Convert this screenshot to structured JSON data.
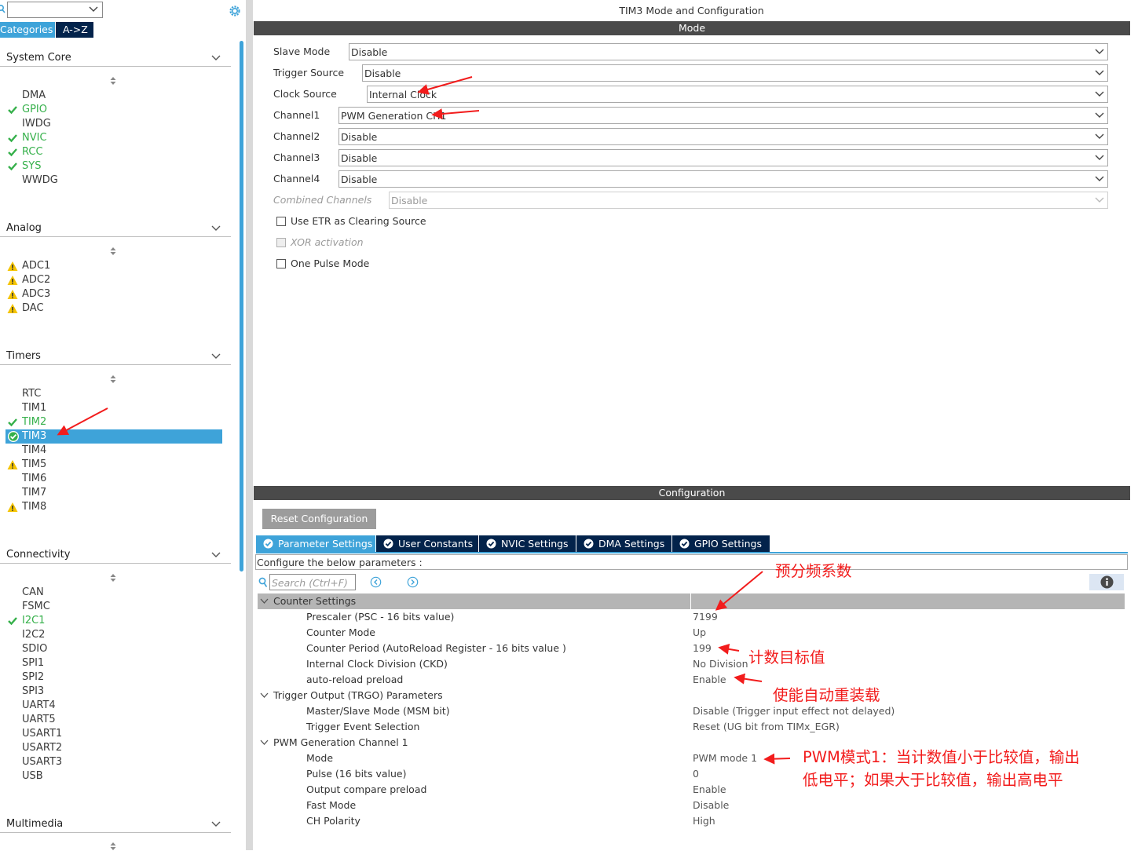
{
  "sidebar": {
    "tabs": {
      "categories": "Categories",
      "az": "A->Z"
    },
    "sections": [
      {
        "title": "System Core",
        "items": [
          {
            "label": "DMA",
            "status": "none"
          },
          {
            "label": "GPIO",
            "status": "ok"
          },
          {
            "label": "IWDG",
            "status": "none"
          },
          {
            "label": "NVIC",
            "status": "ok"
          },
          {
            "label": "RCC",
            "status": "ok"
          },
          {
            "label": "SYS",
            "status": "ok"
          },
          {
            "label": "WWDG",
            "status": "none"
          }
        ]
      },
      {
        "title": "Analog",
        "items": [
          {
            "label": "ADC1",
            "status": "warn"
          },
          {
            "label": "ADC2",
            "status": "warn"
          },
          {
            "label": "ADC3",
            "status": "warn"
          },
          {
            "label": "DAC",
            "status": "warn"
          }
        ]
      },
      {
        "title": "Timers",
        "items": [
          {
            "label": "RTC",
            "status": "none"
          },
          {
            "label": "TIM1",
            "status": "none"
          },
          {
            "label": "TIM2",
            "status": "ok"
          },
          {
            "label": "TIM3",
            "status": "selected"
          },
          {
            "label": "TIM4",
            "status": "none"
          },
          {
            "label": "TIM5",
            "status": "warn"
          },
          {
            "label": "TIM6",
            "status": "none"
          },
          {
            "label": "TIM7",
            "status": "none"
          },
          {
            "label": "TIM8",
            "status": "warn"
          }
        ]
      },
      {
        "title": "Connectivity",
        "items": [
          {
            "label": "CAN",
            "status": "none"
          },
          {
            "label": "FSMC",
            "status": "none"
          },
          {
            "label": "I2C1",
            "status": "ok"
          },
          {
            "label": "I2C2",
            "status": "none"
          },
          {
            "label": "SDIO",
            "status": "none"
          },
          {
            "label": "SPI1",
            "status": "none"
          },
          {
            "label": "SPI2",
            "status": "none"
          },
          {
            "label": "SPI3",
            "status": "none"
          },
          {
            "label": "UART4",
            "status": "none"
          },
          {
            "label": "UART5",
            "status": "none"
          },
          {
            "label": "USART1",
            "status": "none"
          },
          {
            "label": "USART2",
            "status": "none"
          },
          {
            "label": "USART3",
            "status": "none"
          },
          {
            "label": "USB",
            "status": "none"
          }
        ]
      },
      {
        "title": "Multimedia",
        "items": []
      }
    ]
  },
  "main": {
    "title": "TIM3 Mode and Configuration",
    "mode_header": "Mode",
    "mode_rows": [
      {
        "label": "Slave Mode",
        "value": "Disable",
        "disabled": false
      },
      {
        "label": "Trigger Source",
        "value": "Disable",
        "disabled": false
      },
      {
        "label": "Clock Source",
        "value": "Internal Clock",
        "disabled": false
      },
      {
        "label": "Channel1",
        "value": "PWM Generation CH1",
        "disabled": false
      },
      {
        "label": "Channel2",
        "value": "Disable",
        "disabled": false
      },
      {
        "label": "Channel3",
        "value": "Disable",
        "disabled": false
      },
      {
        "label": "Channel4",
        "value": "Disable",
        "disabled": false
      },
      {
        "label": "Combined Channels",
        "value": "Disable",
        "disabled": true
      }
    ],
    "checkboxes": [
      {
        "label": "Use ETR as Clearing Source",
        "checked": false,
        "disabled": false
      },
      {
        "label": "XOR activation",
        "checked": false,
        "disabled": true
      },
      {
        "label": "One Pulse Mode",
        "checked": false,
        "disabled": false
      }
    ],
    "config_header": "Configuration",
    "reset_button": "Reset Configuration",
    "config_tabs": [
      {
        "label": "Parameter Settings",
        "active": true
      },
      {
        "label": "User Constants",
        "active": false
      },
      {
        "label": "NVIC Settings",
        "active": false
      },
      {
        "label": "DMA Settings",
        "active": false
      },
      {
        "label": "GPIO Settings",
        "active": false
      }
    ],
    "description": "Configure the below parameters :",
    "search_placeholder": "Search (Ctrl+F)",
    "parameters": [
      {
        "kind": "group",
        "name": "Counter Settings",
        "value": "",
        "highlight": true
      },
      {
        "kind": "leaf",
        "name": "Prescaler (PSC - 16 bits value)",
        "value": "7199"
      },
      {
        "kind": "leaf",
        "name": "Counter Mode",
        "value": "Up"
      },
      {
        "kind": "leaf",
        "name": "Counter Period (AutoReload Register - 16 bits value )",
        "value": "199"
      },
      {
        "kind": "leaf",
        "name": "Internal Clock Division (CKD)",
        "value": "No Division"
      },
      {
        "kind": "leaf",
        "name": "auto-reload preload",
        "value": "Enable"
      },
      {
        "kind": "group",
        "name": "Trigger Output (TRGO) Parameters",
        "value": "",
        "highlight": false
      },
      {
        "kind": "leaf",
        "name": "Master/Slave Mode (MSM bit)",
        "value": "Disable (Trigger input effect not delayed)"
      },
      {
        "kind": "leaf",
        "name": "Trigger Event Selection",
        "value": "Reset (UG bit from TIMx_EGR)"
      },
      {
        "kind": "group",
        "name": "PWM Generation Channel 1",
        "value": "",
        "highlight": false
      },
      {
        "kind": "leaf",
        "name": "Mode",
        "value": "PWM mode 1"
      },
      {
        "kind": "leaf",
        "name": "Pulse (16 bits value)",
        "value": "0"
      },
      {
        "kind": "leaf",
        "name": "Output compare preload",
        "value": "Enable"
      },
      {
        "kind": "leaf",
        "name": "Fast Mode",
        "value": "Disable"
      },
      {
        "kind": "leaf",
        "name": "CH Polarity",
        "value": "High"
      }
    ]
  },
  "annotations": {
    "prescaler": "预分频系数",
    "period": "计数目标值",
    "preload": "使能自动重装载",
    "pwm_line1": "PWM模式1：当计数值小于比较值，输出",
    "pwm_line2": "低电平；如果大于比较值，输出高电平"
  },
  "colors": {
    "accent": "#3ea3d9",
    "navy": "#03234b",
    "ok_green": "#35b04a",
    "warn_yellow": "#f5c400",
    "annotation_red": "#f21c1c",
    "header_dark": "#4a4a4a"
  }
}
